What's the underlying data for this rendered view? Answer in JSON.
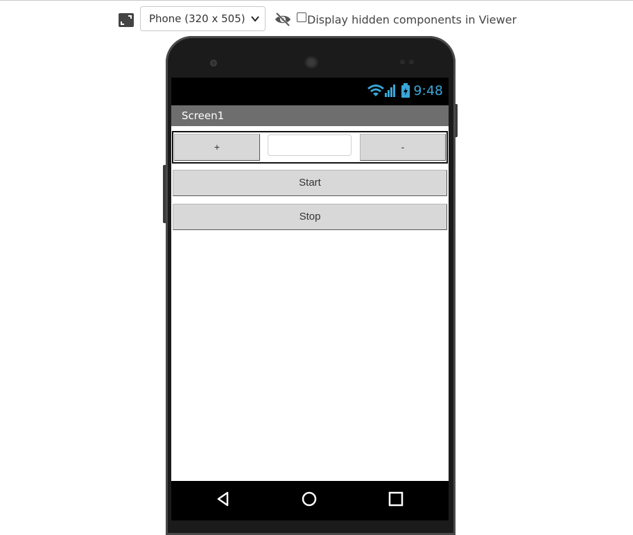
{
  "toolbar": {
    "device_select_value": "Phone (320 x 505)",
    "hidden_components_label": "Display hidden components in Viewer",
    "hidden_components_checked": false
  },
  "phone": {
    "status_time": "9:48",
    "screen_title": "Screen1"
  },
  "components": {
    "plus_button_label": "+",
    "minus_button_label": "-",
    "textbox_value": "",
    "start_button_label": "Start",
    "stop_button_label": "Stop"
  },
  "colors": {
    "status_accent": "#3aa6d8",
    "titlebar": "#6e6e6e",
    "button_bg": "#d8d8d8"
  },
  "icons": {
    "size": "resize-icon",
    "visibility": "eye-off-icon",
    "nav_back": "back-triangle-icon",
    "nav_home": "home-circle-icon",
    "nav_recent": "recents-square-icon",
    "wifi": "wifi-icon",
    "signal": "signal-icon",
    "battery": "battery-charging-icon"
  }
}
